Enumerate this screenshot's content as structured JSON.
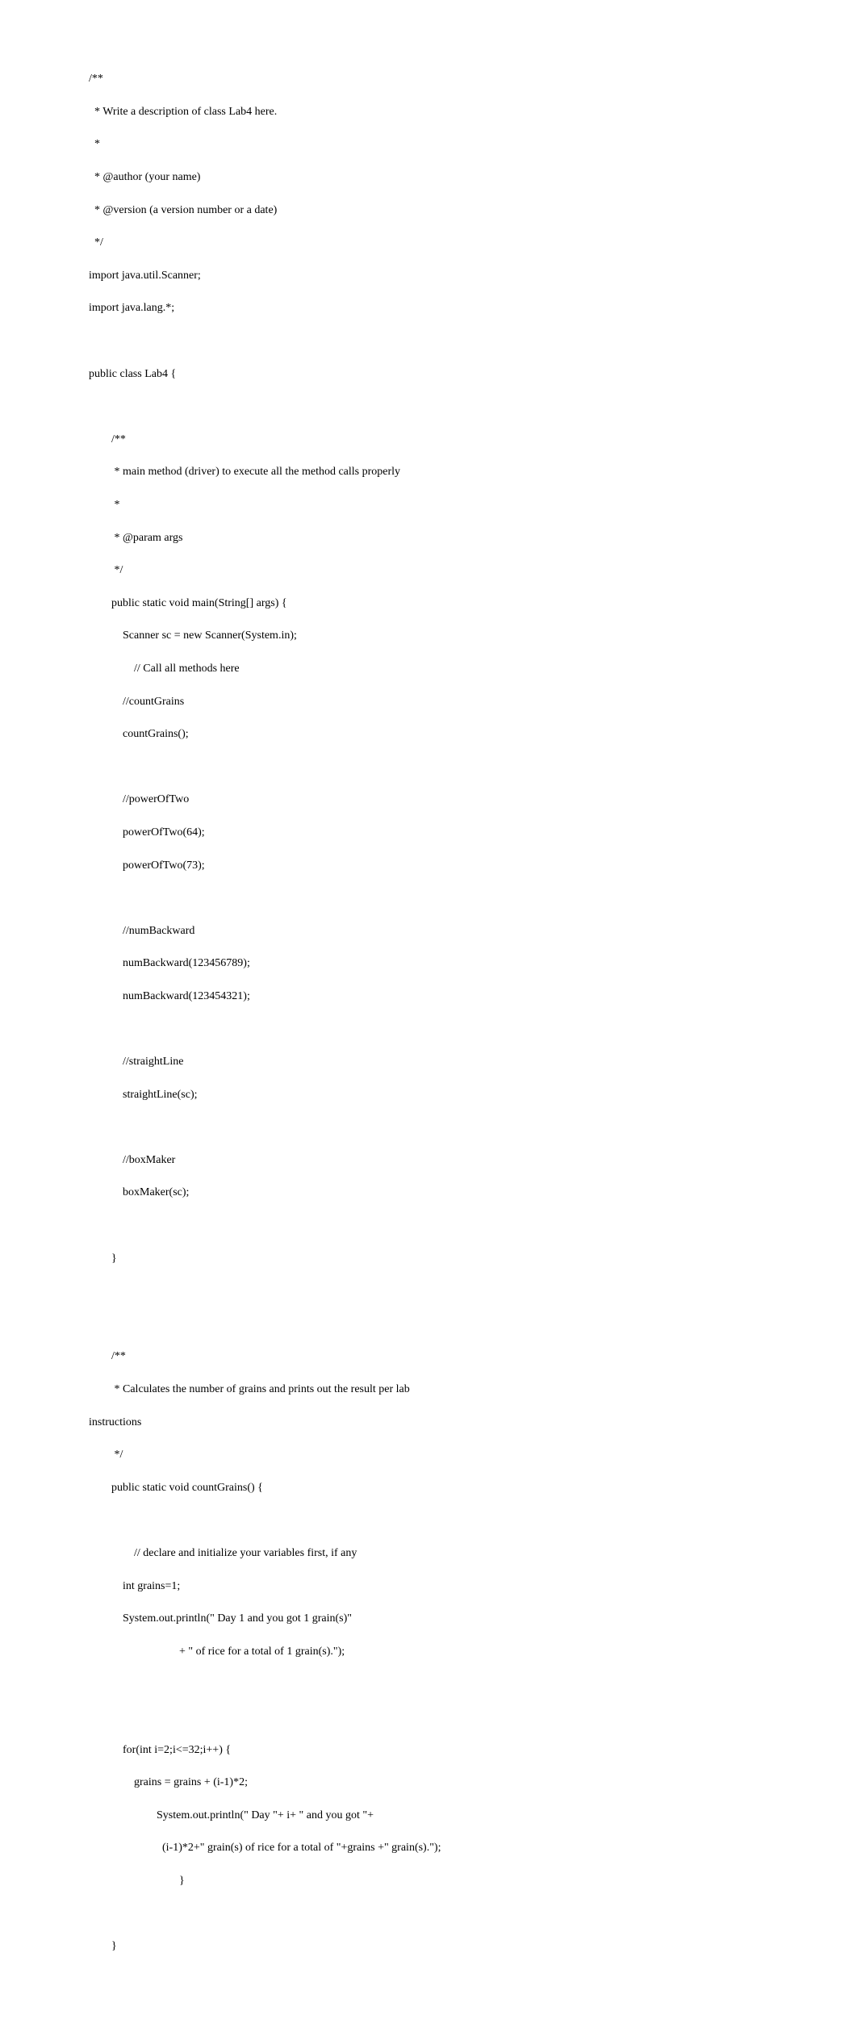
{
  "code": {
    "l1": "/**",
    "l2": "  * Write a description of class Lab4 here.",
    "l3": "  *",
    "l4": "  * @author (your name)",
    "l5": "  * @version (a version number or a date)",
    "l6": "  */",
    "l7": "import java.util.Scanner;",
    "l8": "import java.lang.*;",
    "l9": "",
    "l10": "public class Lab4 {",
    "l11": "",
    "l12": "        /**",
    "l13": "         * main method (driver) to execute all the method calls properly",
    "l14": "         *",
    "l15": "         * @param args",
    "l16": "         */",
    "l17": "        public static void main(String[] args) {",
    "l18": "            Scanner sc = new Scanner(System.in);",
    "l19": "                // Call all methods here",
    "l20": "            //countGrains",
    "l21": "            countGrains();",
    "l22": "",
    "l23": "            //powerOfTwo",
    "l24": "            powerOfTwo(64);",
    "l25": "            powerOfTwo(73);",
    "l26": "",
    "l27": "            //numBackward",
    "l28": "            numBackward(123456789);",
    "l29": "            numBackward(123454321);",
    "l30": "",
    "l31": "            //straightLine",
    "l32": "            straightLine(sc);",
    "l33": "",
    "l34": "            //boxMaker",
    "l35": "            boxMaker(sc);",
    "l36": "",
    "l37": "        }",
    "l38": "",
    "l39": "",
    "l40": "        /**",
    "l41": "         * Calculates the number of grains and prints out the result per lab",
    "l42": "instructions",
    "l43": "         */",
    "l44": "        public static void countGrains() {",
    "l45": "",
    "l46": "                // declare and initialize your variables first, if any",
    "l47": "            int grains=1;",
    "l48": "            System.out.println(\" Day 1 and you got 1 grain(s)\"",
    "l49": "                                + \" of rice for a total of 1 grain(s).\");",
    "l50": "",
    "l51": "",
    "l52": "            for(int i=2;i<=32;i++) {",
    "l53": "                grains = grains + (i-1)*2;",
    "l54": "                        System.out.println(\" Day \"+ i+ \" and you got \"+",
    "l55": "                          (i-1)*2+\" grain(s) of rice for a total of \"+grains +\" grain(s).\");",
    "l56": "                                }",
    "l57": "",
    "l58": "        }"
  }
}
